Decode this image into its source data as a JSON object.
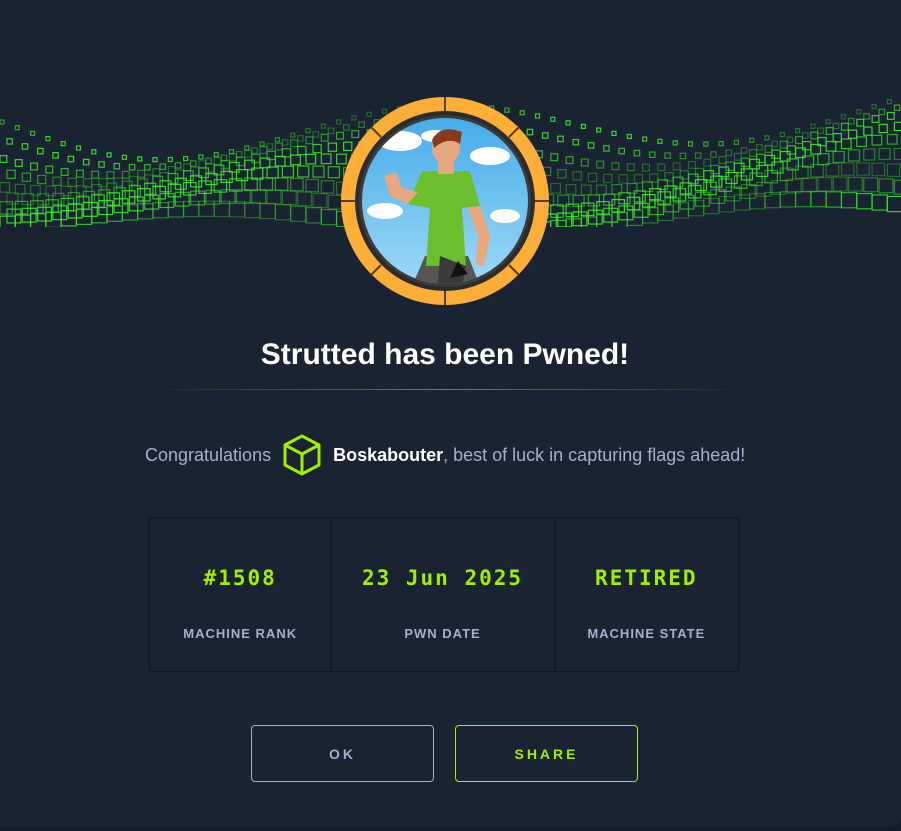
{
  "dialog": {
    "title": "Strutted has been Pwned!",
    "congrats_prefix": "Congratulations",
    "username": "Boskabouter",
    "congrats_suffix": ", best of luck in capturing flags ahead!"
  },
  "stats": [
    {
      "value": "#1508",
      "label": "MACHINE RANK"
    },
    {
      "value": "23 Jun 2025",
      "label": "PWN DATE"
    },
    {
      "value": "RETIRED",
      "label": "MACHINE STATE"
    }
  ],
  "buttons": {
    "ok": "OK",
    "share": "SHARE"
  },
  "icons": {
    "user_badge": "cube-icon",
    "machine_avatar": "machine-avatar"
  },
  "colors": {
    "accent": "#9fef00",
    "background": "#1a2332",
    "ring": "#ffaf38",
    "muted_text": "#a4b1cd"
  }
}
